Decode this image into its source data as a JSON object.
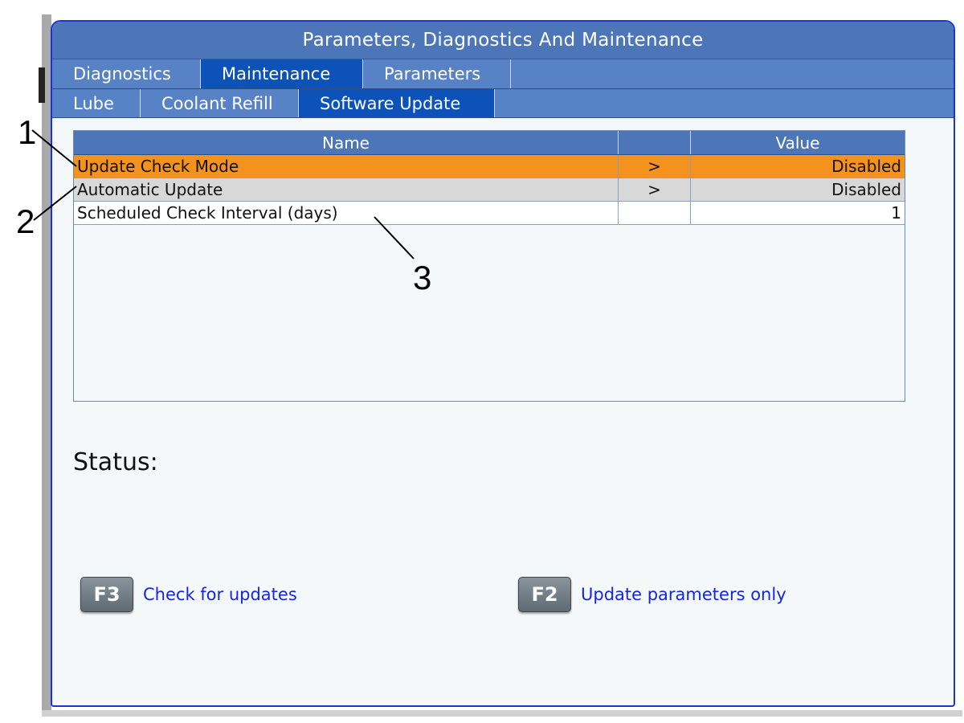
{
  "window": {
    "title": "Parameters, Diagnostics And Maintenance"
  },
  "tabs": [
    {
      "label": "Diagnostics",
      "active": false
    },
    {
      "label": "Maintenance",
      "active": true
    },
    {
      "label": "Parameters",
      "active": false
    }
  ],
  "subtabs": [
    {
      "label": "Lube",
      "active": false
    },
    {
      "label": "Coolant Refill",
      "active": false
    },
    {
      "label": "Software Update",
      "active": true
    }
  ],
  "grid": {
    "headers": {
      "name": "Name",
      "arrow": "",
      "value": "Value"
    },
    "rows": [
      {
        "name": "Update Check Mode",
        "arrow": ">",
        "value": "Disabled",
        "selected": true
      },
      {
        "name": "Automatic Update",
        "arrow": ">",
        "value": "Disabled",
        "selected": false
      },
      {
        "name": "Scheduled Check Interval (days)",
        "arrow": "",
        "value": "1",
        "selected": false
      }
    ]
  },
  "status": {
    "label": "Status:"
  },
  "actions": {
    "check": {
      "key": "F3",
      "label": "Check for updates"
    },
    "params": {
      "key": "F2",
      "label": "Update parameters only"
    }
  },
  "callouts": [
    "1",
    "2",
    "3"
  ],
  "colors": {
    "title_blue": "#4d76b9",
    "active_tab": "#0d52b8",
    "selected_row": "#f5921e",
    "link_blue": "#1427e0",
    "border_blue": "#1c33d8"
  }
}
